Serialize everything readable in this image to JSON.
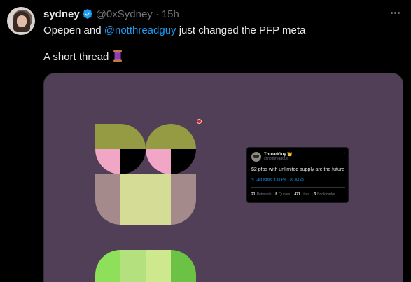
{
  "author": {
    "display_name": "sydney",
    "handle": "@0xSydney",
    "separator": "·",
    "timestamp": "15h",
    "verified_icon": "verified-badge-icon",
    "verified_color": "#1d9bf0"
  },
  "tweet": {
    "line1_prefix": "Opepen and ",
    "mention": "@notthreadguy",
    "line1_suffix": " just changed the PFP meta",
    "line2": "A short thread",
    "line2_emoji_icon": "thread-spool-icon"
  },
  "media": {
    "background_color": "#503f56",
    "embedded_tweet": {
      "display_name": "ThreadGuy 👑",
      "handle": "@notthreadguy",
      "text": "$2 pfps with unlimited supply are the future",
      "edited_label": "Last edited 9:33 PM · 16 Jul 23",
      "stats": [
        {
          "count": "21",
          "label": "Retweets"
        },
        {
          "count": "8",
          "label": "Quotes"
        },
        {
          "count": "471",
          "label": "Likes"
        },
        {
          "count": "3",
          "label": "Bookmarks"
        }
      ]
    }
  },
  "colors": {
    "background": "#000000",
    "text_primary": "#e7e9ea",
    "text_secondary": "#71767b",
    "accent": "#1d9bf0"
  }
}
